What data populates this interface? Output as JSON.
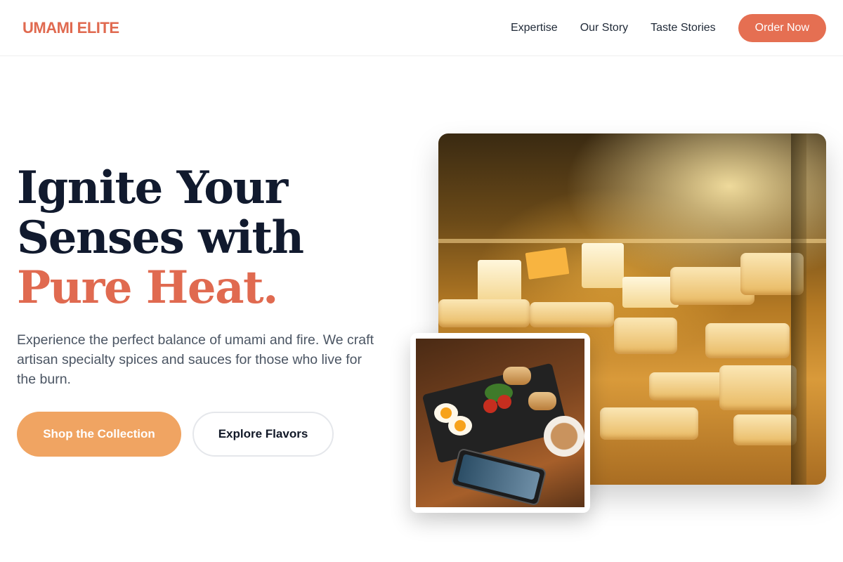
{
  "header": {
    "logo": "UMAMI ELITE",
    "nav": [
      "Expertise",
      "Our Story",
      "Taste Stories"
    ],
    "cta": "Order Now"
  },
  "hero": {
    "title_line1": "Ignite Your",
    "title_line2": "Senses with",
    "title_accent": "Pure Heat.",
    "description": "Experience the perfect balance of umami and fire. We craft artisan specialty spices and sauces for those who live for the burn.",
    "primary_button": "Shop the Collection",
    "secondary_button": "Explore Flavors"
  },
  "colors": {
    "accent": "#e06a50",
    "primary_button": "#f0a462",
    "heading": "#111a2e",
    "body_text": "#4b5563"
  }
}
